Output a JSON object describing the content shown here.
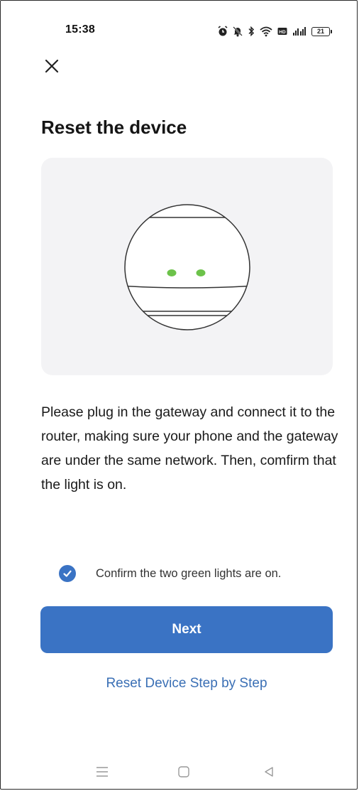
{
  "status_bar": {
    "time": "15:38",
    "battery": "21",
    "icons": [
      "alarm-icon",
      "mute-icon",
      "bluetooth-icon",
      "wifi-icon",
      "hd-icon",
      "signal-icon",
      "battery-icon"
    ]
  },
  "header": {
    "close_icon": "close-icon",
    "title": "Reset the device"
  },
  "illustration": {
    "description_icon": "gateway-device-illustration",
    "light_color": "#6cc24a"
  },
  "instructions": "Please plug in the gateway and connect it to the router, making sure your phone and the gateway are under the same network. Then, comfirm that the light is on.",
  "confirm": {
    "checked": true,
    "label": "Confirm the two green lights are on."
  },
  "actions": {
    "next_label": "Next",
    "reset_link_label": "Reset Device Step by Step"
  },
  "nav_bar": {
    "icons": [
      "menu-icon",
      "home-icon",
      "back-icon"
    ]
  },
  "colors": {
    "primary": "#3a73c4",
    "link": "#3a6fb5",
    "card_bg": "#f3f3f5"
  }
}
